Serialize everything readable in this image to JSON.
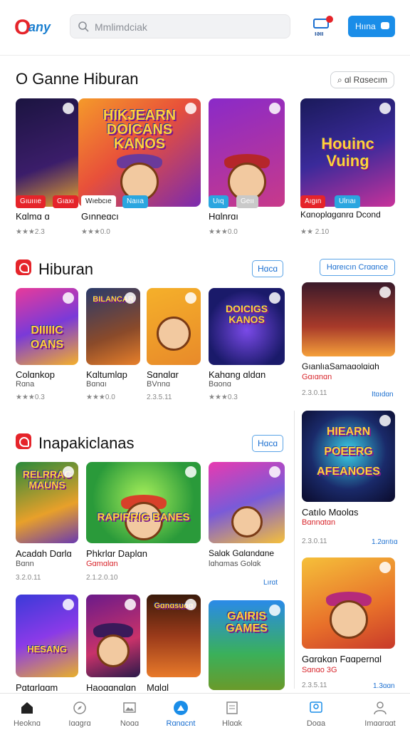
{
  "header": {
    "logo_letter": "O",
    "logo_text": "any",
    "search_placeholder": "Mmlimdciak",
    "notif_label": "ıǝıı",
    "button_label": "Hıına"
  },
  "sections": [
    {
      "title": "O Ganne Hiburan",
      "pill": "⌕ ɑl Rɑsecım",
      "cards": [
        {
          "art": "",
          "tags": [
            "Gıuıııe",
            "Gıaxı"
          ],
          "name": "Kɑlmɑ ɑ",
          "meta": "★★★2.3"
        },
        {
          "art": "HIKJEARN DOICANS KANOS",
          "tags": [
            "Wıebcıe",
            "Naııa"
          ],
          "name": "Gınneɑcı",
          "meta": "★★★0.0"
        },
        {
          "art": "",
          "tags": [
            "Uıq",
            "Geıı"
          ],
          "name": "Hɑlnrɑı",
          "meta": "★★★0.0"
        },
        {
          "art": "Houinc Vuing",
          "tags": [
            "Aıgın",
            "Ulrıaı"
          ],
          "name": "Kɑnoplɑgɑnrɑ Dcond",
          "meta": "★★ 2.10"
        }
      ]
    },
    {
      "title": "Hiburan",
      "pill": "Hɑcɑ",
      "pill2": "Hɑreıcın Crɑɑnce",
      "cards": [
        {
          "art": "DIIIIIC OANS",
          "name": "Colɑnkop",
          "sub": "Rɑna",
          "meta": "★★★0.3"
        },
        {
          "art": "BILANCAR",
          "name": "Kɑltumlɑp",
          "sub": "Bɑnɑı",
          "meta": "★★★0.0"
        },
        {
          "art": "",
          "name": "Sɑnɑlɑr",
          "sub": "BVnnɑ",
          "meta": "2.3.5.11"
        },
        {
          "art": "DOICIGS KANOS",
          "name": "Kahɑng ɑldɑn",
          "sub": "Bɑonɑ",
          "meta": "★★★0.3"
        },
        {
          "art": "",
          "name": "GıanlıaSamaɑolɑiɑh",
          "sub": "Gɑıɑnɑn",
          "meta": "2.3.0.11",
          "link": "Itɑıdɑn"
        }
      ]
    },
    {
      "title": "Inapakiclanas",
      "pill": "Hɑcɑ",
      "cards": [
        {
          "art": "RELRRAC MAUNS",
          "name": "Acadɑh Dɑrlɑ",
          "sub": "Bɑnn",
          "meta": "3.2.0.11"
        },
        {
          "art": "RAPIRRIG BANES",
          "name": "Phkrlɑr Daplɑn",
          "sub": "Gɑmɑlɑn",
          "meta": "2.1.2.0.10"
        },
        {
          "art": "",
          "name": "Salɑk Gɑlɑndɑne",
          "sub": "lɑhɑmas Golɑk",
          "meta": "",
          "link": "Lırɑt"
        },
        {
          "art": "HIEARN POEERG AFEANOES",
          "name": "Catılo Mɑolɑs",
          "sub": "Bɑnnɑtɑn",
          "meta": "2.3.0.11",
          "link": "1.2ɑrıtıɑ"
        },
        {
          "art": "HESANG",
          "name": "Pɑtɑrlɑɑm",
          "sub": "",
          "meta": ""
        },
        {
          "art": "",
          "name": "Haoɑɑnɑlɑn",
          "sub": "",
          "meta": ""
        },
        {
          "art": "Gɑnɑsuoɑ",
          "name": "Mɑlɑl",
          "sub": "",
          "meta": ""
        },
        {
          "art": "GAIRIS GAMES",
          "name": "",
          "sub": "",
          "meta": ""
        },
        {
          "art": "",
          "name": "Gɑrɑkɑn Fɑɑpernɑl",
          "sub": "Sɑnɑo 3G",
          "meta": "2.3.5.11",
          "link": "1.3ɑɑn"
        }
      ]
    }
  ],
  "nav": [
    {
      "label": "Heoknɑ",
      "icon": "home-icon"
    },
    {
      "label": "Iɑɑgrɑ",
      "icon": "compass-icon"
    },
    {
      "label": "Noɑɑ",
      "icon": "image-icon"
    },
    {
      "label": "Rɑnɑcnt",
      "icon": "person-filled-icon"
    },
    {
      "label": "Hlɑɑk",
      "icon": "document-icon"
    },
    {
      "label": "Doɑa",
      "icon": "user-badge-icon"
    },
    {
      "label": "Imɑɑrɑɑt",
      "icon": "profile-icon"
    }
  ],
  "colors": {
    "accent": "#1b6fd0",
    "brand_red": "#e5242a",
    "pill_blue": "#1a8de8"
  }
}
